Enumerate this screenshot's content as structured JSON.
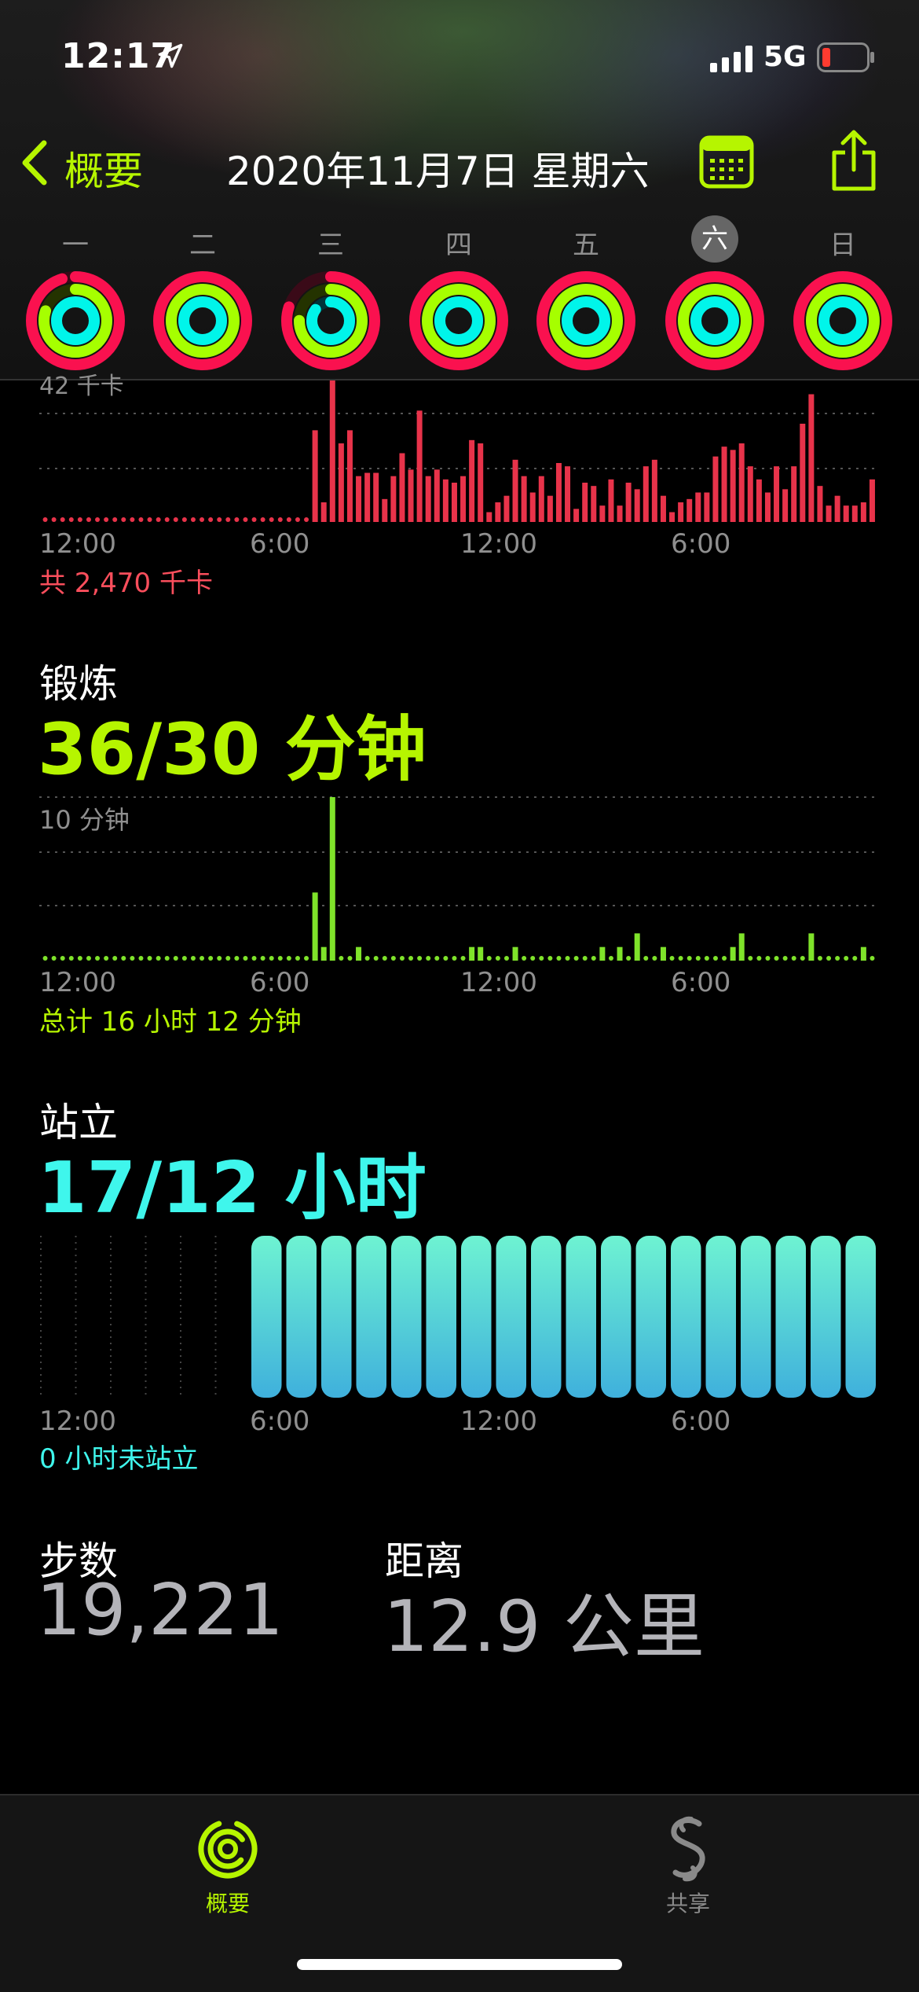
{
  "status_bar": {
    "time": "12:17",
    "network": "5G"
  },
  "nav": {
    "back_label": "概要",
    "title": "2020年11月7日 星期六"
  },
  "week": {
    "days": [
      "一",
      "二",
      "三",
      "四",
      "五",
      "六",
      "日"
    ],
    "selected_index": 5
  },
  "colors": {
    "move": "#fa114f",
    "exercise": "#a6ff00",
    "stand": "#00f5ea",
    "accent": "#b6f500"
  },
  "move_section": {
    "partial_label": "42 千卡",
    "ticks": [
      "12:00",
      "6:00",
      "12:00",
      "6:00"
    ],
    "summary": "共 2,470 千卡"
  },
  "exercise_section": {
    "title": "锻炼",
    "value": "36/30 分钟",
    "top_label": "10 分钟",
    "ticks": [
      "12:00",
      "6:00",
      "12:00",
      "6:00"
    ],
    "summary": "总计 16 小时 12 分钟"
  },
  "stand_section": {
    "title": "站立",
    "value": "17/12 小时",
    "ticks": [
      "12:00",
      "6:00",
      "12:00",
      "6:00"
    ],
    "summary": "0 小时未站立"
  },
  "steps": {
    "label": "步数",
    "value": "19,221"
  },
  "distance": {
    "label": "距离",
    "value": "12.9 公里"
  },
  "tabs": [
    {
      "label": "概要"
    },
    {
      "label": "共享"
    }
  ],
  "chart_data": [
    {
      "type": "bar",
      "name": "move",
      "unit": "千卡",
      "bins": 96,
      "values": [
        0,
        0,
        0,
        0,
        0,
        0,
        0,
        0,
        0,
        0,
        0,
        0,
        0,
        0,
        0,
        0,
        0,
        0,
        0,
        0,
        0,
        0,
        0,
        0,
        0,
        0,
        0,
        0,
        0,
        0,
        0,
        28,
        6,
        49,
        24,
        28,
        14,
        15,
        15,
        7,
        14,
        21,
        16,
        34,
        14,
        16,
        13,
        12,
        14,
        25,
        24,
        3,
        6,
        8,
        19,
        14,
        9,
        14,
        8,
        18,
        17,
        4,
        12,
        11,
        5,
        13,
        5,
        12,
        10,
        17,
        19,
        8,
        3,
        6,
        7,
        9,
        9,
        20,
        23,
        22,
        24,
        17,
        13,
        9,
        17,
        10,
        17,
        30,
        39,
        11,
        5,
        8,
        5,
        5,
        6,
        13
      ],
      "ylim": [
        0,
        42
      ]
    },
    {
      "type": "bar",
      "name": "exercise",
      "unit": "分钟",
      "bins": 96,
      "values": [
        0,
        0,
        0,
        0,
        0,
        0,
        0,
        0,
        0,
        0,
        0,
        0,
        0,
        0,
        0,
        0,
        0,
        0,
        0,
        0,
        0,
        0,
        0,
        0,
        0,
        0,
        0,
        0,
        0,
        0,
        0,
        5,
        1,
        12,
        0,
        0,
        1,
        0,
        0,
        0,
        0,
        0,
        0,
        0,
        0,
        0,
        0,
        0,
        0,
        1,
        1,
        0,
        0,
        0,
        1,
        0,
        0,
        0,
        0,
        0,
        0,
        0,
        0,
        0,
        1,
        0,
        1,
        0,
        2,
        0,
        0,
        1,
        0,
        0,
        0,
        0,
        0,
        0,
        0,
        1,
        2,
        0,
        0,
        0,
        0,
        0,
        0,
        0,
        2,
        0,
        0,
        0,
        0,
        0,
        1,
        0
      ],
      "ylim": [
        0,
        12
      ]
    },
    {
      "type": "bar",
      "name": "stand",
      "unit": "小时",
      "hours": 24,
      "stood": [
        0,
        0,
        0,
        0,
        0,
        0,
        0,
        1,
        1,
        1,
        1,
        1,
        1,
        1,
        1,
        1,
        1,
        1,
        1,
        1,
        1,
        1,
        1,
        1,
        1
      ]
    }
  ]
}
